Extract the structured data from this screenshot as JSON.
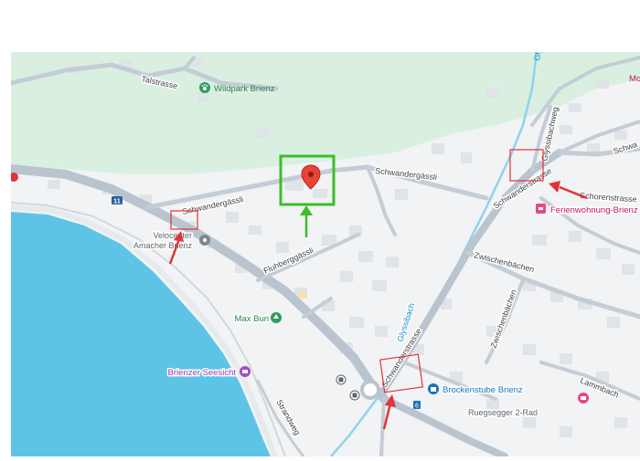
{
  "map": {
    "streets": {
      "talstrasse": "Talstrasse",
      "schwandergassli_top": "Schwandergässli",
      "schwandergassli_left": "Schwandergässli",
      "fluhberggassli": "Fluhberggässli",
      "schwanderstrasse_top": "Schwanderstrasse",
      "schwanderstrasse_bottom": "Schwanderstrasse",
      "glyssibachweg": "Glyssibachweg",
      "schorenstrasse": "Schorenstrasse",
      "zwischenbachen": "Zwischenbächen",
      "zwischenbachen_v": "Zwischenbächen",
      "lammbach": "Lammbach",
      "strandweg": "Strandweg",
      "schwa": "Schwa",
      "road_number": "11"
    },
    "water": {
      "glyssibach": "Glyssibach",
      "gly_top": "Gly"
    },
    "pois": {
      "wildpark": "Wildpark Brienz",
      "velocenter_line1": "Velocenter",
      "velocenter_line2": "Amacher Brienz",
      "max_buri": "Max Buri",
      "seesicht": "Brienzer Seesicht",
      "ferienwohnung": "Ferienwohnung-Brienz",
      "brockenstube": "Brockenstube Brienz",
      "ruegsegger": "Ruegsegger 2-Rad",
      "mo": "Mo",
      "stop_sign_number": "6"
    },
    "colors": {
      "land": "#f1f3f4",
      "forest": "#d9f0e1",
      "lake": "#5ec4e6",
      "road": "#c4cdd6",
      "building": "#e0e3e7",
      "river": "#8fd3ec",
      "annotation_red": "#e0333a",
      "annotation_green": "#3cbd2c",
      "pin": "#ea4335"
    }
  }
}
